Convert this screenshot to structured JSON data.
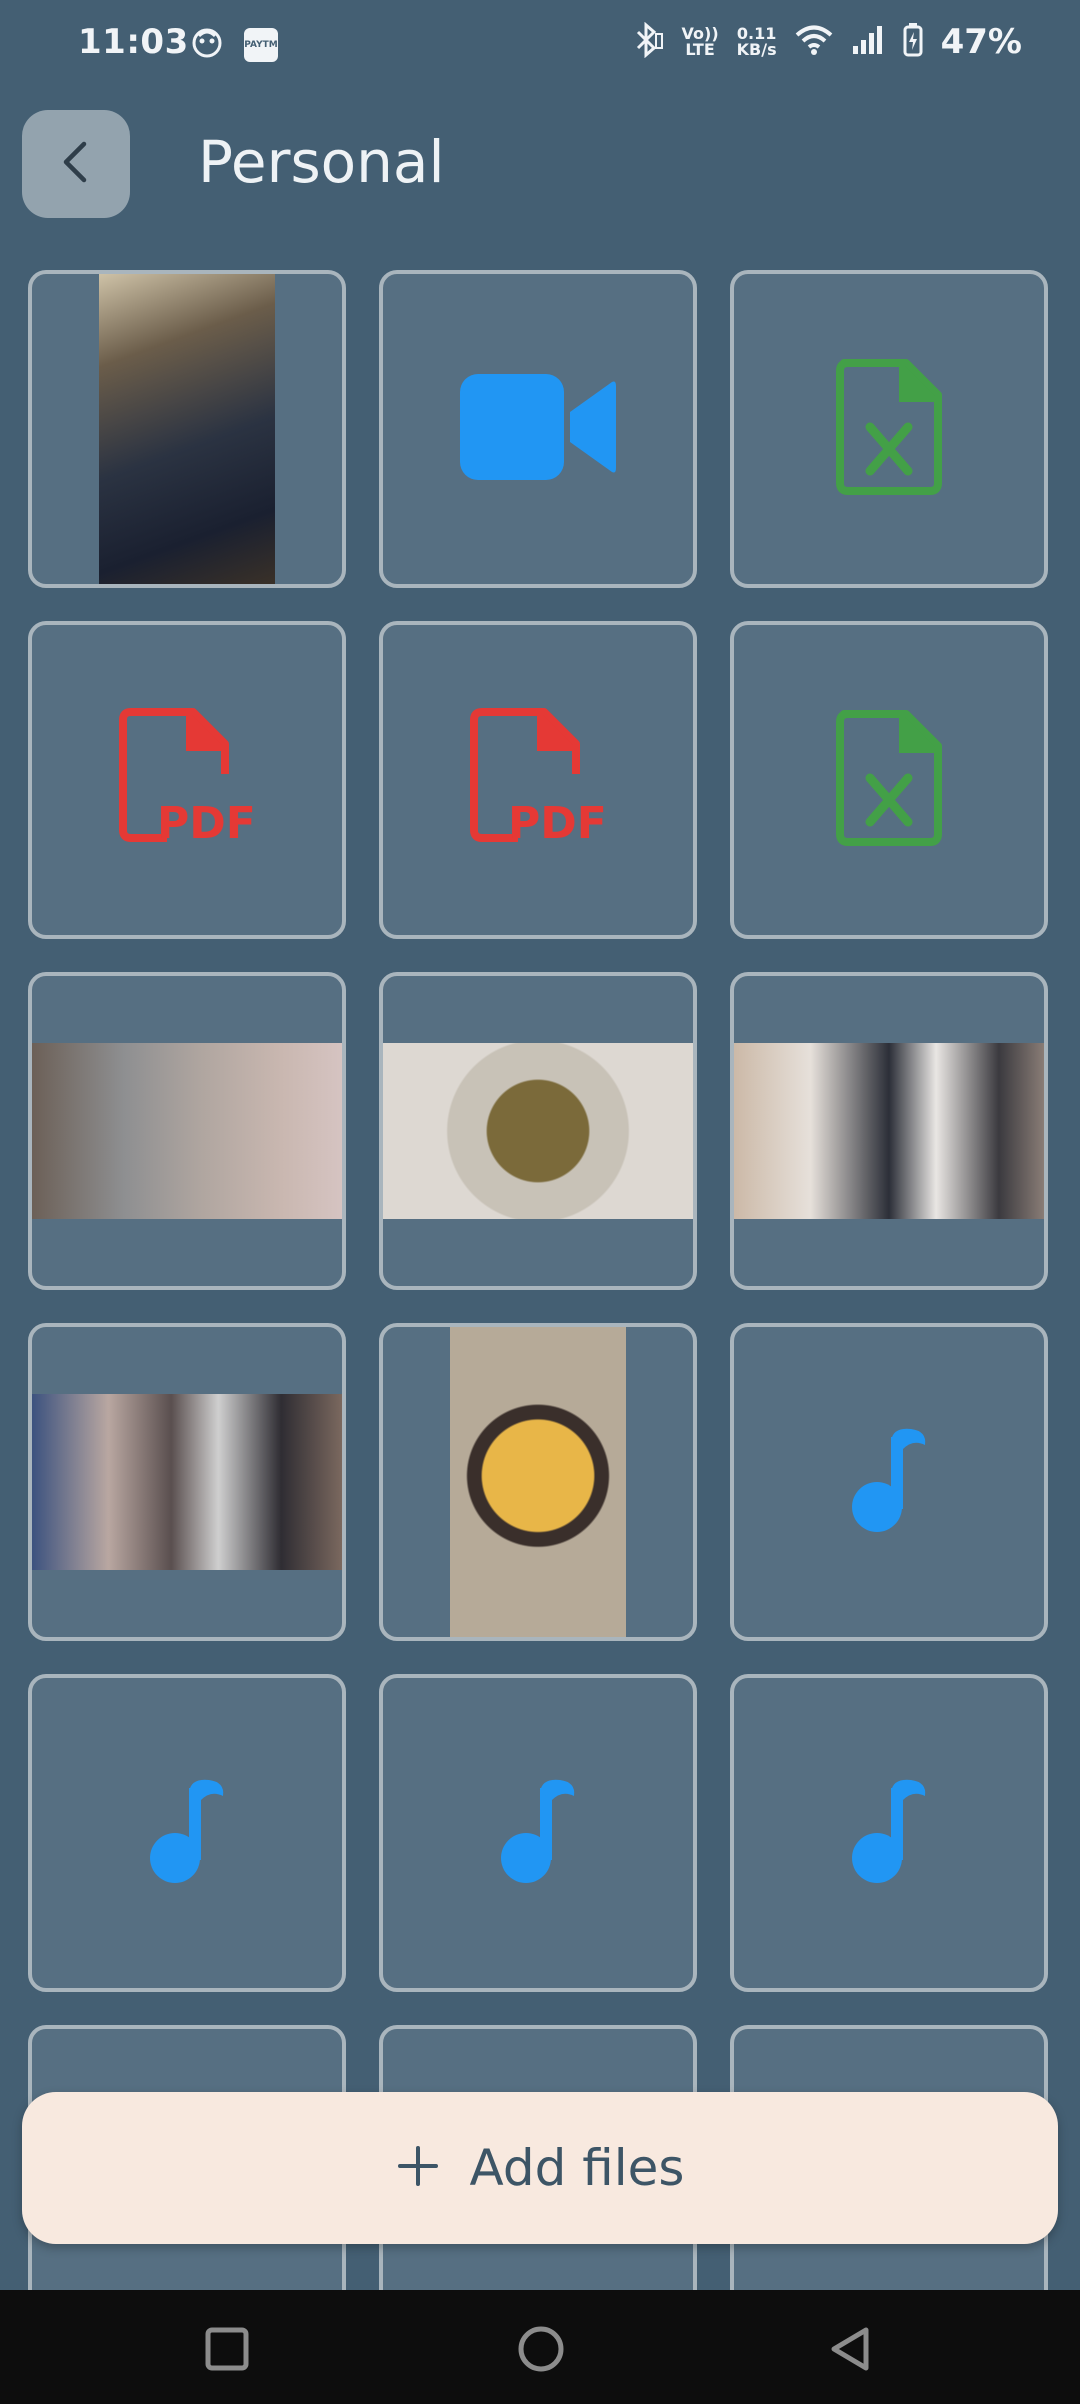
{
  "status_bar": {
    "time": "11:03",
    "network_speed_value": "0.11",
    "network_speed_unit": "KB/s",
    "lte_top": "Vo))",
    "lte_bottom": "LTE",
    "battery_percent": "47%",
    "paytm_label": "PAYTM"
  },
  "header": {
    "title": "Personal"
  },
  "colors": {
    "background": "#445f73",
    "tile": "#566f82",
    "video_icon": "#2196f3",
    "excel_icon": "#43a047",
    "pdf_icon": "#e53935",
    "music_icon": "#2196f3",
    "add_button_bg": "#f8e9df"
  },
  "files": [
    {
      "type": "image",
      "icon": "photo-desk-setup"
    },
    {
      "type": "video",
      "icon": "video-camera-icon"
    },
    {
      "type": "excel",
      "icon": "excel-file-icon"
    },
    {
      "type": "pdf",
      "icon": "pdf-file-icon",
      "label": "PDF"
    },
    {
      "type": "pdf",
      "icon": "pdf-file-icon",
      "label": "PDF"
    },
    {
      "type": "excel",
      "icon": "excel-file-icon"
    },
    {
      "type": "image",
      "icon": "photo-holi-group"
    },
    {
      "type": "image",
      "icon": "photo-food-plate"
    },
    {
      "type": "image",
      "icon": "photo-mall-group"
    },
    {
      "type": "image",
      "icon": "photo-cinema-group"
    },
    {
      "type": "image",
      "icon": "photo-pizza"
    },
    {
      "type": "audio",
      "icon": "music-note-icon"
    },
    {
      "type": "audio",
      "icon": "music-note-icon"
    },
    {
      "type": "audio",
      "icon": "music-note-icon"
    },
    {
      "type": "audio",
      "icon": "music-note-icon"
    }
  ],
  "add_button": {
    "label": "Add files",
    "icon": "plus-icon"
  },
  "nav_bar": {
    "recents_icon": "square-icon",
    "home_icon": "circle-icon",
    "back_icon": "triangle-back-icon"
  }
}
